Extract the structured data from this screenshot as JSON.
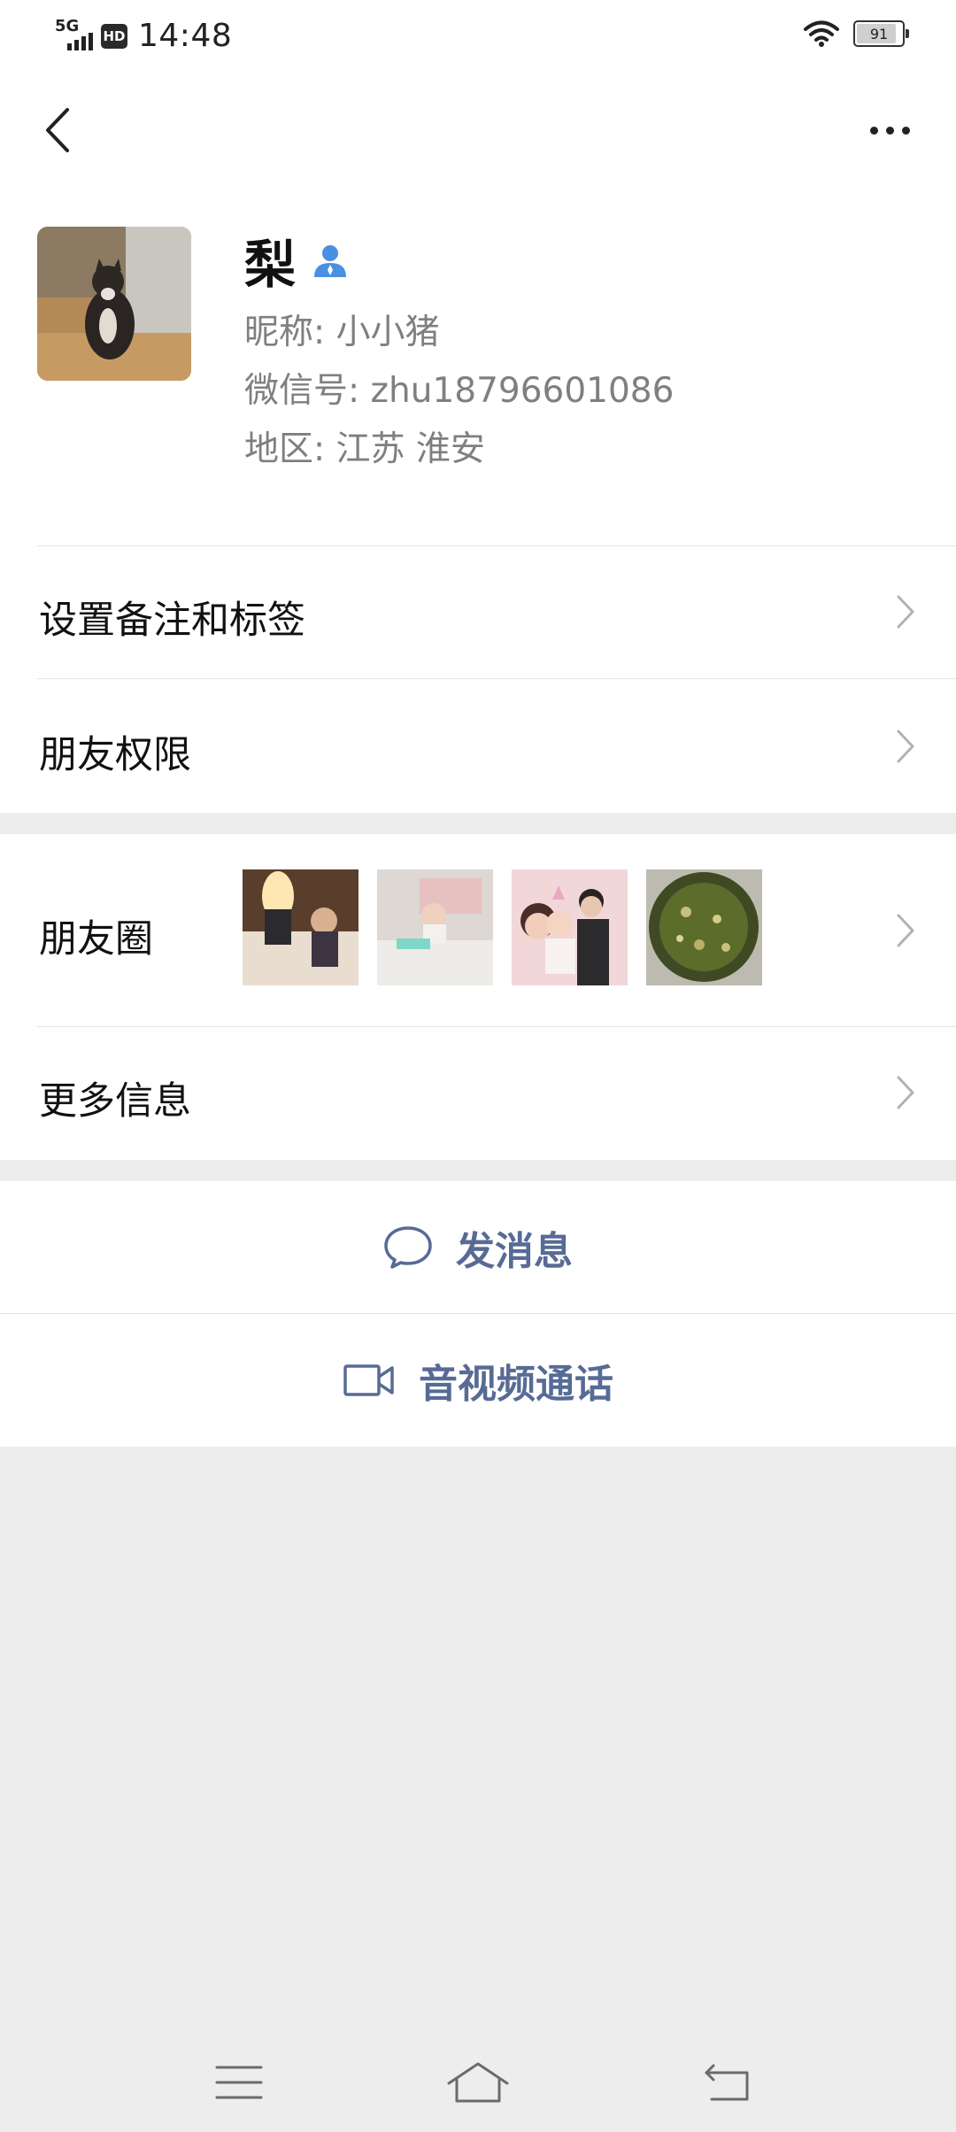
{
  "status_bar": {
    "network": "5G",
    "hd": "HD",
    "time": "14:48",
    "battery": "91",
    "battery_level": 0.91
  },
  "profile": {
    "name": "梨",
    "nickname": "昵称:  小小猪",
    "wechat_id": "微信号:  zhu18796601086",
    "region": "地区:  江苏  淮安"
  },
  "menu": {
    "remark_tags": "设置备注和标签",
    "friend_permissions": "朋友权限",
    "moments": "朋友圈",
    "more_info": "更多信息"
  },
  "actions": {
    "send_message": "发消息",
    "video_call": "音视频通话"
  },
  "icons": [
    "back-icon",
    "more-icon",
    "contact-icon",
    "chevron-right-icon",
    "chat-bubble-icon",
    "video-camera-icon",
    "menu-icon",
    "home-icon",
    "return-icon",
    "wifi-icon",
    "battery-icon"
  ],
  "colors": {
    "link_blue": "#576b95",
    "contact_icon_blue": "#4a90e2",
    "background": "#ededed"
  }
}
